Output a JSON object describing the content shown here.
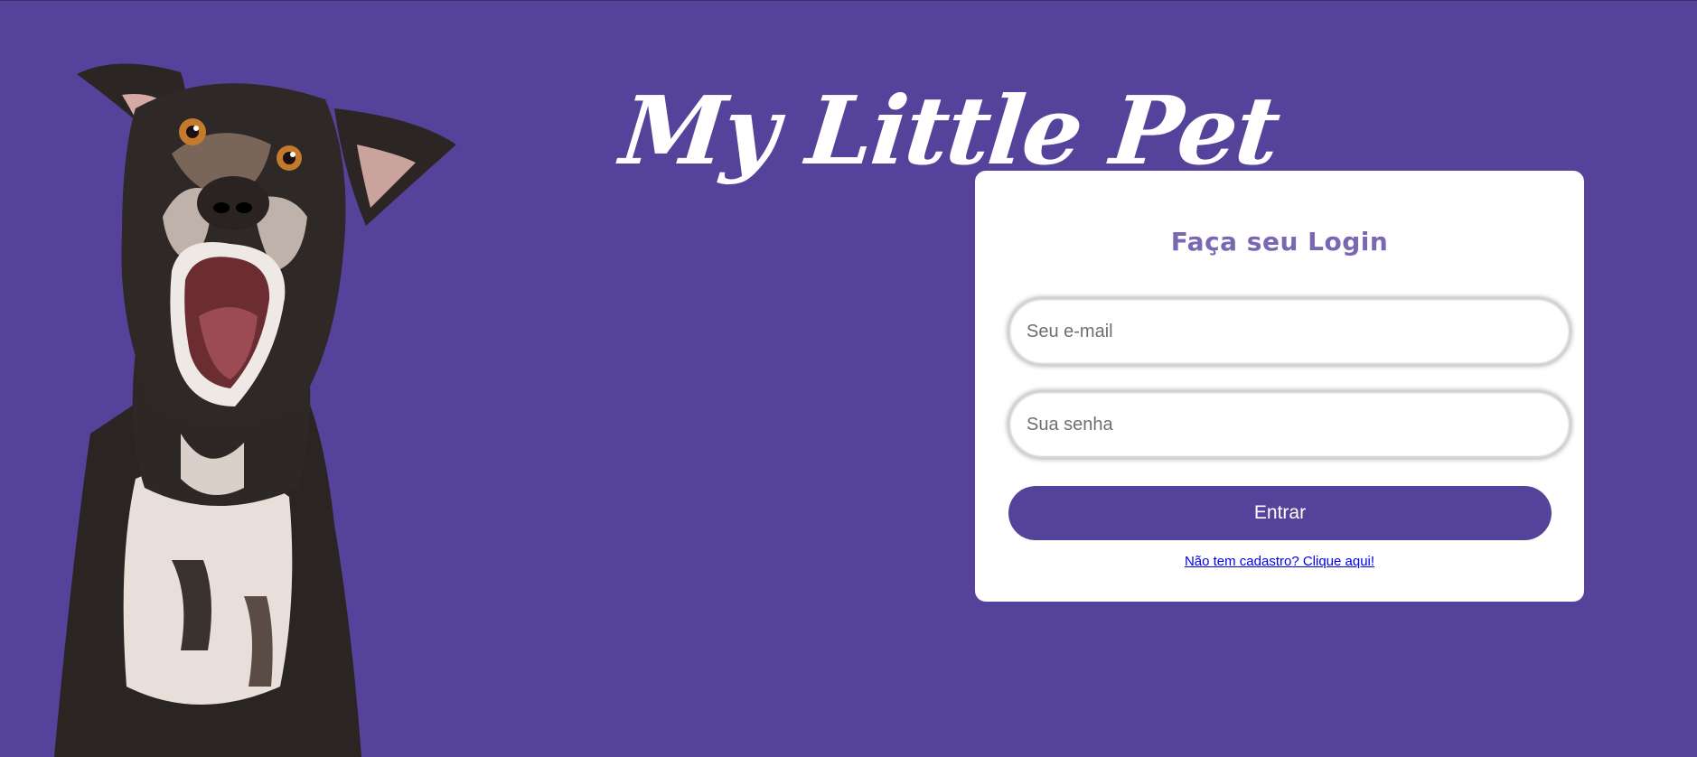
{
  "brand": {
    "logo_text": "My Little Pet"
  },
  "login": {
    "title": "Faça seu Login",
    "email_placeholder": "Seu e-mail",
    "password_placeholder": "Sua senha",
    "submit_label": "Entrar",
    "register_link": "Não tem cadastro? Clique aqui!"
  },
  "colors": {
    "background": "#55439b",
    "accent": "#55439b",
    "title": "#7a67b3",
    "card": "#ffffff"
  },
  "icons": {
    "hero_image": "dog-photo"
  }
}
